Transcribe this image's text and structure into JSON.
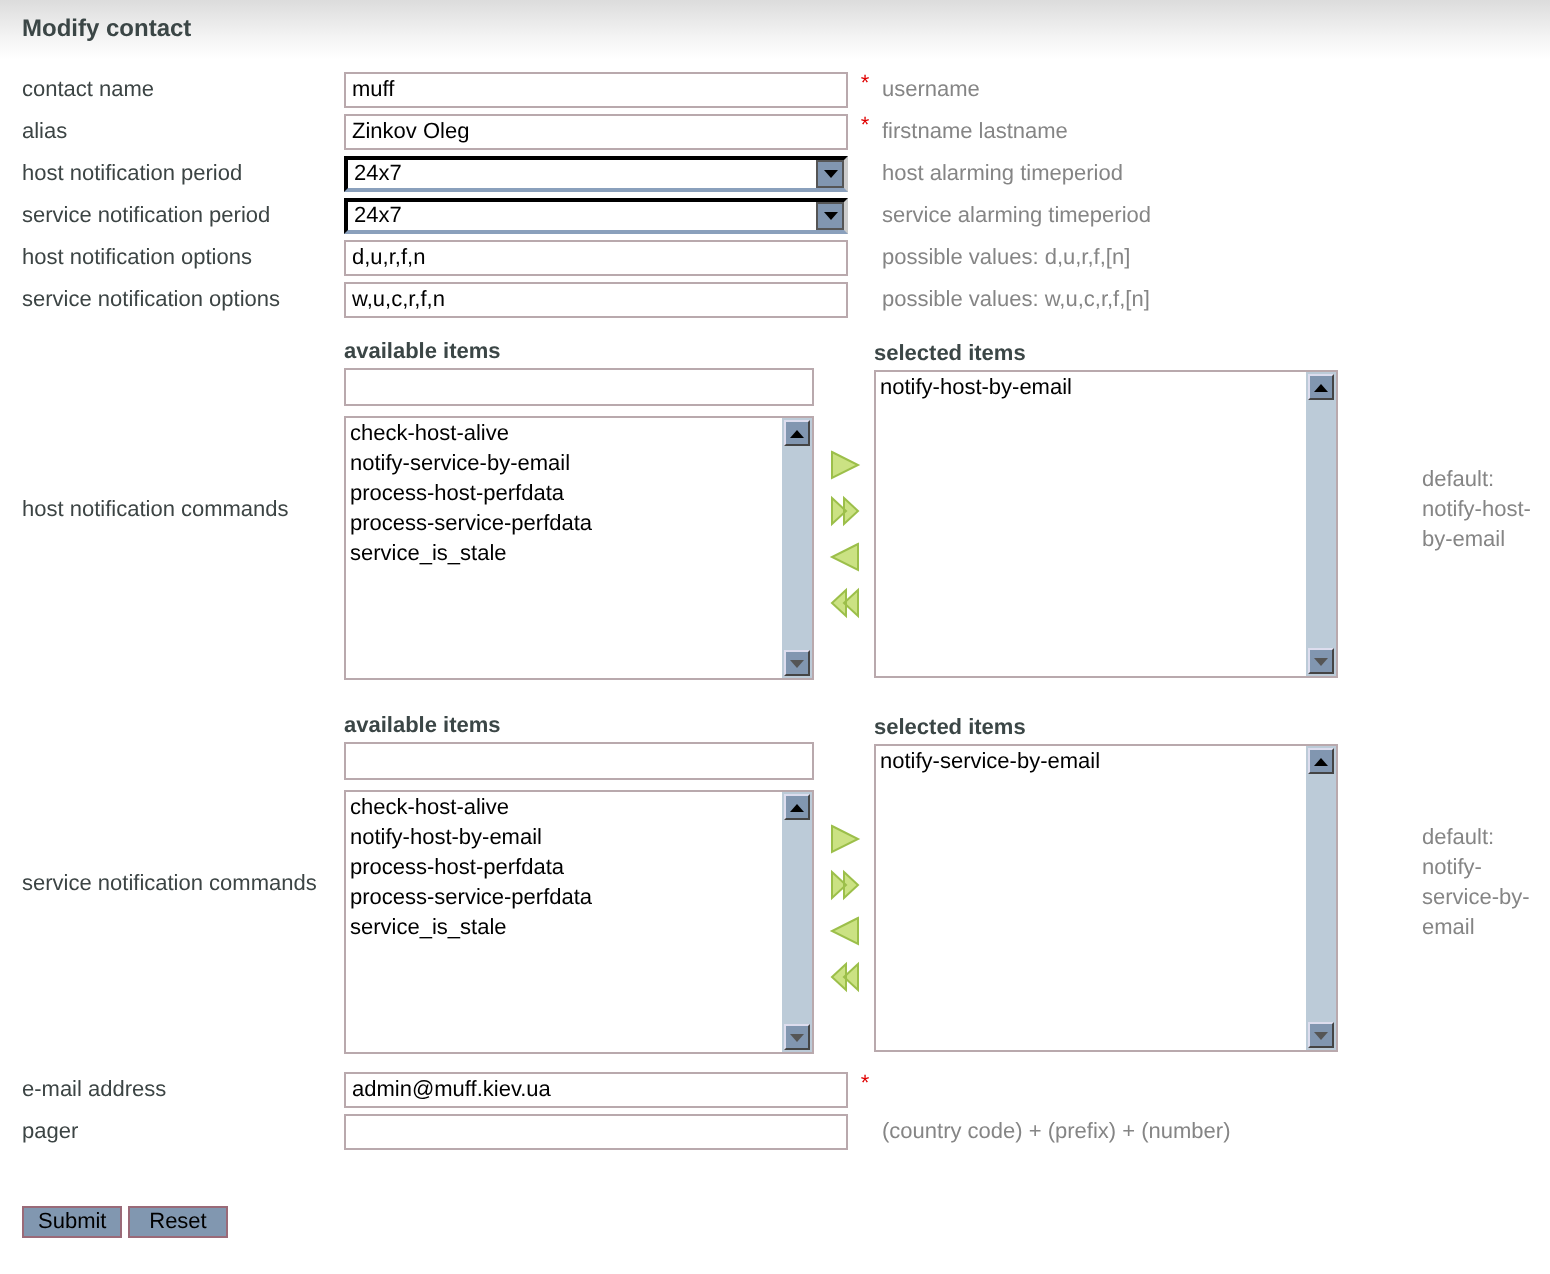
{
  "title": "Modify contact",
  "fields": [
    {
      "kind": "text",
      "label": "contact name",
      "value": "muff",
      "marker": "*",
      "hint": "username"
    },
    {
      "kind": "text",
      "label": "alias",
      "value": "Zinkov Oleg",
      "marker": "*",
      "hint": "firstname lastname"
    },
    {
      "kind": "select",
      "label": "host notification period",
      "value": "24x7",
      "hint": "host alarming timeperiod"
    },
    {
      "kind": "select",
      "label": "service notification period",
      "value": "24x7",
      "hint": "service alarming timeperiod"
    },
    {
      "kind": "text",
      "label": "host notification options",
      "value": "d,u,r,f,n",
      "hint": "possible values: d,u,r,f,[n]"
    },
    {
      "kind": "text",
      "label": "service notification options",
      "value": "w,u,c,r,f,n",
      "hint": "possible values: w,u,c,r,f,[n]"
    },
    {
      "kind": "dual",
      "label": "host notification commands",
      "available_heading": "available items",
      "selected_heading": "selected items",
      "available": [
        "check-host-alive",
        "notify-service-by-email",
        "process-host-perfdata",
        "process-service-perfdata",
        "service_is_stale"
      ],
      "selected": [
        "notify-host-by-email"
      ],
      "hint": "default: notify-host-by-email"
    },
    {
      "kind": "dual",
      "label": "service notification commands",
      "available_heading": "available items",
      "selected_heading": "selected items",
      "available": [
        "check-host-alive",
        "notify-host-by-email",
        "process-host-perfdata",
        "process-service-perfdata",
        "service_is_stale"
      ],
      "selected": [
        "notify-service-by-email"
      ],
      "hint": "default: notify-service-by-email"
    },
    {
      "kind": "text",
      "label": "e-mail address",
      "value": "admin@muff.kiev.ua",
      "marker": "*"
    },
    {
      "kind": "text",
      "label": "pager",
      "hint": "(country code) + (prefix) + (number)"
    }
  ],
  "buttons": [
    "Submit",
    "Reset"
  ]
}
